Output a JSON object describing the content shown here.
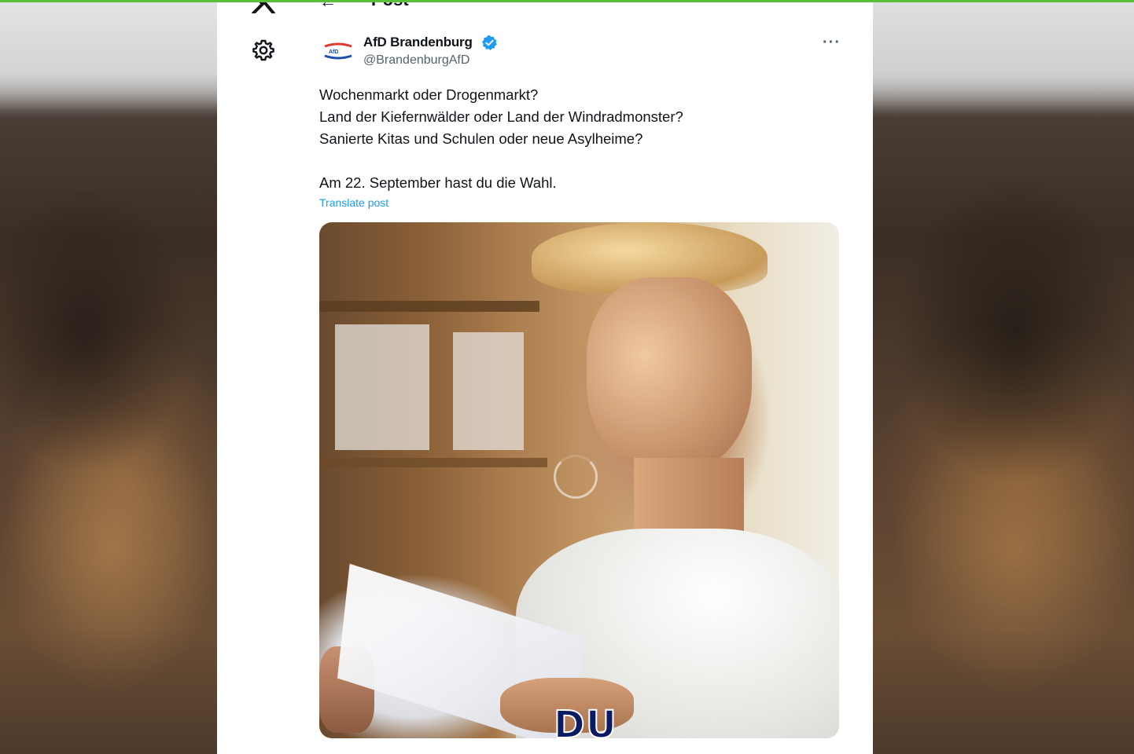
{
  "header": {
    "back_glyph": "←",
    "title": "Post"
  },
  "post": {
    "author_name": "AfD Brandenburg",
    "author_handle": "@BrandenburgAfD",
    "verified": true,
    "more_glyph": "···",
    "lines": [
      "Wochenmarkt oder Drogenmarkt?",
      "Land der Kiefernwälder oder Land der Windradmonster?",
      "Sanierte Kitas und Schulen oder neue Asylheime?",
      "Am 22. September hast du die Wahl."
    ],
    "translate_label": "Translate post",
    "image_overlay_text": "DU"
  },
  "colors": {
    "accent": "#1d9bf0",
    "text": "#0f1419",
    "secondary_text": "#536471",
    "top_bar": "#5bbf3a",
    "overlay_text": "#0a1a63"
  },
  "icons": {
    "close": "x-logo-icon",
    "settings": "gear-icon",
    "verified": "verified-badge-icon",
    "more": "more-options-icon"
  }
}
